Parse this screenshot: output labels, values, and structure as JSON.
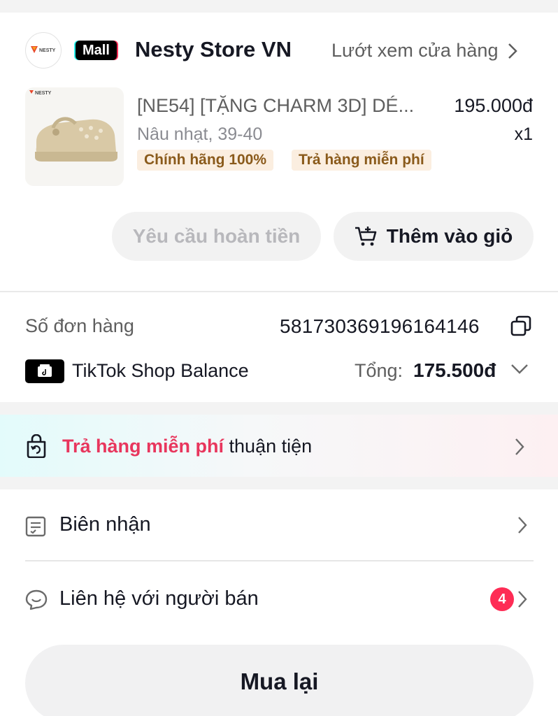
{
  "store": {
    "logo_text": "NESTY",
    "mall_badge": "Mall",
    "name": "Nesty Store VN",
    "browse_link": "Lướt xem cửa hàng"
  },
  "product": {
    "image_brand": "NESTY",
    "title": "[NE54] [TẶNG CHARM 3D] DÉ...",
    "price": "195.000đ",
    "variant": "Nâu nhạt, 39-40",
    "quantity": "x1",
    "tags": [
      "Chính hãng 100%",
      "Trả hàng miễn phí"
    ]
  },
  "actions": {
    "refund_label": "Yêu cầu hoàn tiền",
    "add_to_cart_label": "Thêm vào giỏ"
  },
  "order": {
    "number_label": "Số đơn hàng",
    "number": "581730369196164146",
    "payment_method": "TikTok Shop Balance",
    "total_label": "Tổng:",
    "total_value": "175.500đ"
  },
  "return_banner": {
    "highlight": "Trả hàng miễn phí",
    "rest": " thuận tiện"
  },
  "rows": {
    "receipt_label": "Biên nhận",
    "contact_label": "Liên hệ với người bán",
    "contact_badge": "4"
  },
  "rebuy_label": "Mua lại",
  "colors": {
    "accent_red": "#fe2c55",
    "tag_bg": "#fbeee0",
    "tag_text": "#8a5a1b",
    "highlight_text": "#e8365d"
  }
}
